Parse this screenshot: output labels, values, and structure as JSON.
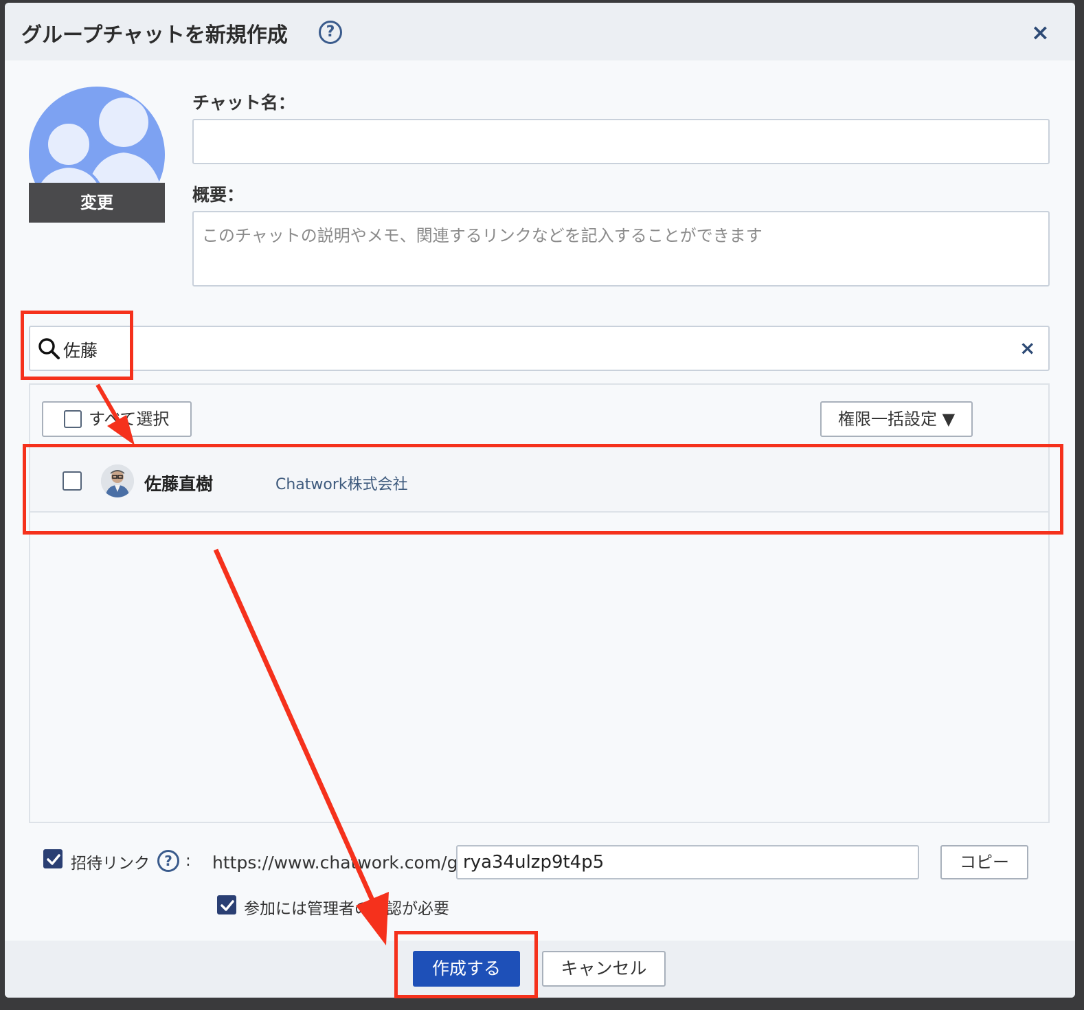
{
  "dialog": {
    "title": "グループチャットを新規作成",
    "help_icon": "question-circle-icon",
    "close_icon": "close-icon",
    "close_glyph": "×"
  },
  "avatar": {
    "change_label": "変更"
  },
  "form": {
    "chat_name_label": "チャット名：",
    "chat_name_value": "",
    "description_label": "概要：",
    "description_placeholder": "このチャットの説明やメモ、関連するリンクなどを記入することができます"
  },
  "search": {
    "value": "佐藤",
    "clear_glyph": "×"
  },
  "member_list": {
    "select_all_label": "すべて選択",
    "bulk_permission_label": "権限一括設定 ▼",
    "members": [
      {
        "name": "佐藤直樹",
        "organization": "Chatwork株式会社",
        "checked": false
      }
    ]
  },
  "invite": {
    "enabled": true,
    "label": "招待リンク",
    "help_glyph": "?",
    "colon": ":",
    "url_prefix": "https://www.chatwork.com/g/",
    "code": "rya34ulzp9t4p5",
    "copy_label": "コピー",
    "approval_required": true,
    "approval_label": "参加には管理者の承認が必要"
  },
  "footer": {
    "create_label": "作成する",
    "cancel_label": "キャンセル"
  },
  "colors": {
    "primary_button": "#1e50b8",
    "annotation_red": "#f5311c",
    "checkbox_checked": "#2a3f73"
  }
}
